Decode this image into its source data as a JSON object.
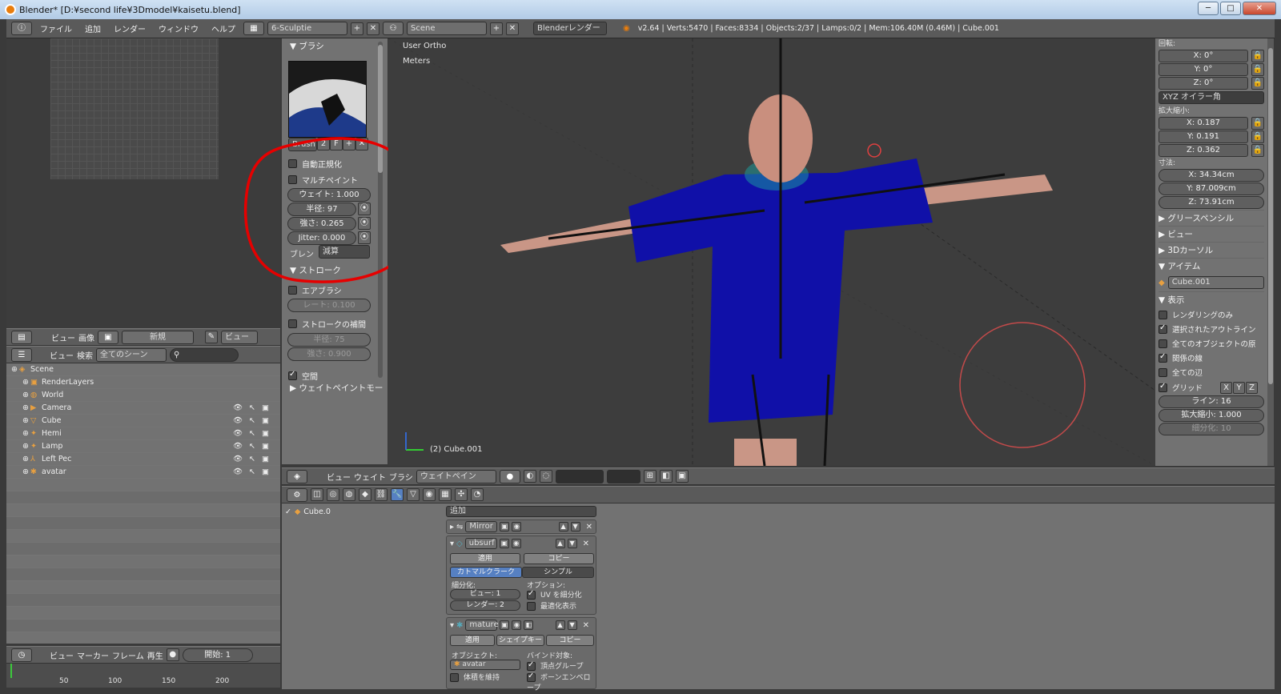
{
  "window": {
    "title": "Blender* [D:¥second life¥3Dmodel¥kaisetu.blend]",
    "min": "─",
    "max": "□",
    "close": "✕"
  },
  "menu": {
    "items": [
      "ファイル",
      "追加",
      "レンダー",
      "ウィンドウ",
      "ヘルプ"
    ],
    "layout": "6-Sculptie",
    "scene": "Scene",
    "engine": "Blenderレンダー",
    "stats": "v2.64 | Verts:5470 | Faces:8334 | Objects:2/37 | Lamps:0/2 | Mem:106.40M (0.46M) | Cube.001"
  },
  "image_header": {
    "items": [
      "ビュー",
      "画像"
    ],
    "new_label": "新規",
    "view_label": "ビュー"
  },
  "outliner": {
    "header_items": [
      "ビュー",
      "検索"
    ],
    "filter": "全てのシーン",
    "rows": [
      {
        "label": "Scene",
        "indent": 0,
        "icon": "scene-icon"
      },
      {
        "label": "RenderLayers",
        "indent": 1,
        "icon": "render-icon"
      },
      {
        "label": "World",
        "indent": 1,
        "icon": "world-icon"
      },
      {
        "label": "Camera",
        "indent": 1,
        "icon": "camera-icon",
        "vis": true
      },
      {
        "label": "Cube",
        "indent": 1,
        "icon": "mesh-icon",
        "vis": true
      },
      {
        "label": "Hemi",
        "indent": 1,
        "icon": "lamp-icon",
        "vis": true
      },
      {
        "label": "Lamp",
        "indent": 1,
        "icon": "lamp-icon",
        "vis": true
      },
      {
        "label": "Left Pec",
        "indent": 1,
        "icon": "empty-icon",
        "vis": true
      },
      {
        "label": "avatar",
        "indent": 1,
        "icon": "armature-icon",
        "vis": true
      }
    ]
  },
  "timeline": {
    "items": [
      "ビュー",
      "マーカー",
      "フレーム",
      "再生"
    ],
    "start": "開始: 1",
    "ticks": [
      "50",
      "100",
      "150",
      "200"
    ]
  },
  "tools": {
    "brush_header": "▼ ブラシ",
    "brush_name": "Brush",
    "brush_users": "2",
    "brush_fake": "F",
    "auto_normalize": "自動正規化",
    "multi_paint": "マルチペイント",
    "weight": "ウェイト: 1.000",
    "radius": "半径: 97",
    "strength": "強さ: 0.265",
    "jitter": "Jitter: 0.000",
    "blend_label": "ブレン",
    "blend_value": "減算",
    "stroke_header": "ストローク",
    "airbrush": "エアブラシ",
    "rate": "レート: 0.100",
    "stroke_smooth": "ストロークの補間",
    "smooth_radius": "半径: 75",
    "smooth_strength": "強さ: 0.900",
    "space": "空間",
    "wp_options": "▶ ウェイトペイントモー"
  },
  "viewport": {
    "view_name": "User Ortho",
    "units": "Meters",
    "object": "(2) Cube.001",
    "header_items": [
      "ビュー",
      "ウェイト",
      "ブラシ"
    ],
    "mode": "ウェイトペイン"
  },
  "properties": {
    "rotation_label": "回転:",
    "rot": [
      "X: 0°",
      "Y: 0°",
      "Z: 0°"
    ],
    "rot_mode": "XYZ オイラー角",
    "scale_label": "拡大縮小:",
    "scale": [
      "X: 0.187",
      "Y: 0.191",
      "Z: 0.362"
    ],
    "dim_label": "寸法:",
    "dims": [
      "X: 34.34cm",
      "Y: 87.009cm",
      "Z: 73.91cm"
    ],
    "sections": [
      "▶ グリースペンシル",
      "▶ ビュー",
      "▶ 3Dカーソル",
      "▼ アイテム"
    ],
    "item_name": "Cube.001",
    "display_header": "▼ 表示",
    "display_opts": [
      {
        "label": "レンダリングのみ",
        "on": false
      },
      {
        "label": "選択されたアウトライン",
        "on": true
      },
      {
        "label": "全てのオブジェクトの原",
        "on": false
      },
      {
        "label": "関係の線",
        "on": true
      },
      {
        "label": "全ての辺",
        "on": false
      }
    ],
    "grid_label": "グリッド",
    "grid_axes": [
      "X",
      "Y",
      "Z"
    ],
    "lines": "ライン: 16",
    "grid_scale": "拡大縮小: 1.000",
    "subdiv": "細分化: 10"
  },
  "modifiers": {
    "tree_item": "Cube.0",
    "add_label": "追加",
    "mirror": "Mirror",
    "subsurf": "ubsurf",
    "apply": "適用",
    "copy": "コピー",
    "catmull": "カトマルクラーク",
    "simple": "シンプル",
    "subdiv_label": "細分化:",
    "view_levels": "ビュー: 1",
    "render_levels": "レンダー: 2",
    "options_label": "オプション:",
    "uv_subdiv": "UV を細分化",
    "optimal": "最適化表示",
    "armature": "mature",
    "apply2": "適用",
    "shapekey": "シェイプキー",
    "copy2": "コピー",
    "object_label": "オブジェクト:",
    "object_value": "avatar",
    "bind_label": "バインド対象:",
    "keep_volume": "体積を維持",
    "vgroups": "頂点グループ",
    "envelopes": "ボーンエンベロープ"
  },
  "colors": {
    "accent": "#5680c2",
    "annotation": "#e60000",
    "shirt": "#1010a8",
    "skin": "#c98f7e"
  }
}
